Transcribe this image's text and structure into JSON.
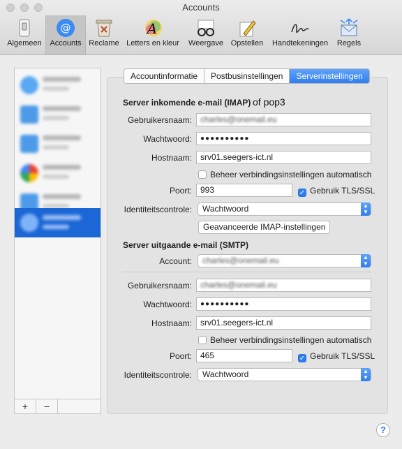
{
  "window": {
    "title": "Accounts"
  },
  "toolbar": {
    "items": [
      {
        "label": "Algemeen",
        "icon": "switch-icon"
      },
      {
        "label": "Accounts",
        "icon": "at-icon",
        "selected": true
      },
      {
        "label": "Reclame",
        "icon": "junk-bin-icon"
      },
      {
        "label": "Letters en kleur",
        "icon": "font-color-icon"
      },
      {
        "label": "Weergave",
        "icon": "glasses-icon"
      },
      {
        "label": "Opstellen",
        "icon": "compose-pencil-icon"
      },
      {
        "label": "Handtekeningen",
        "icon": "signature-icon"
      },
      {
        "label": "Regels",
        "icon": "rules-envelope-icon"
      }
    ]
  },
  "sidebar": {
    "accounts_count": 6,
    "selected_index": 5,
    "add_label": "+",
    "remove_label": "−"
  },
  "tabs": [
    {
      "label": "Accountinformatie",
      "active": false
    },
    {
      "label": "Postbusinstellingen",
      "active": false
    },
    {
      "label": "Serverinstellingen",
      "active": true
    }
  ],
  "incoming": {
    "title": "Server inkomende e-mail (IMAP)",
    "handwritten_note": "of pop3",
    "username_label": "Gebruikersnaam:",
    "username_value": "charles@onemail.eu",
    "password_label": "Wachtwoord:",
    "password_value": "●●●●●●●●●●",
    "hostname_label": "Hostnaam:",
    "hostname_value": "srv01.seegers-ict.nl",
    "auto_label": "Beheer verbindingsinstellingen automatisch",
    "auto_checked": false,
    "port_label": "Poort:",
    "port_value": "993",
    "tls_label": "Gebruik TLS/SSL",
    "tls_checked": true,
    "auth_label": "Identiteitscontrole:",
    "auth_value": "Wachtwoord",
    "advanced_button": "Geavanceerde IMAP-instellingen"
  },
  "outgoing": {
    "title": "Server uitgaande e-mail (SMTP)",
    "account_label": "Account:",
    "account_value": "charles@onemail.eu",
    "username_label": "Gebruikersnaam:",
    "username_value": "charles@onemail.eu",
    "password_label": "Wachtwoord:",
    "password_value": "●●●●●●●●●●",
    "hostname_label": "Hostnaam:",
    "hostname_value": "srv01.seegers-ict.nl",
    "auto_label": "Beheer verbindingsinstellingen automatisch",
    "auto_checked": false,
    "port_label": "Poort:",
    "port_value": "465",
    "tls_label": "Gebruik TLS/SSL",
    "tls_checked": true,
    "auth_label": "Identiteitscontrole:",
    "auth_value": "Wachtwoord"
  },
  "help": {
    "label": "?"
  },
  "colors": {
    "accent": "#2f7ef1",
    "selection": "#1c67d6"
  }
}
